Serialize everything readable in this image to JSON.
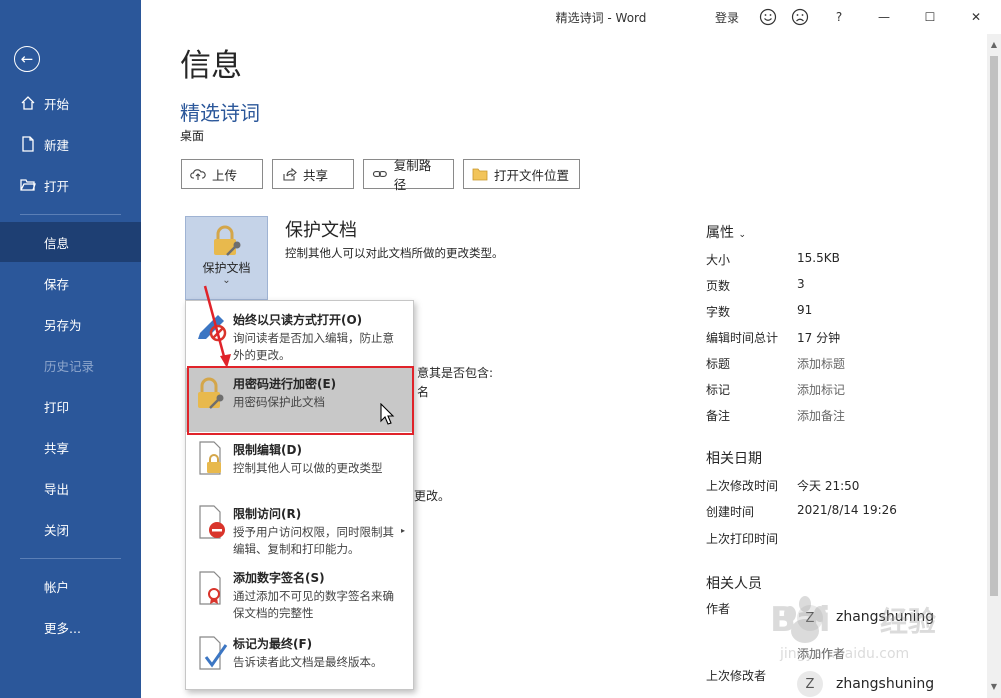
{
  "window": {
    "title": "精选诗词 - Word",
    "signin": "登录",
    "help": "?",
    "minimize": "—",
    "maximize": "☐",
    "close": "✕"
  },
  "sidebar": {
    "back": "←",
    "items": [
      {
        "label": "开始",
        "icon": "home-icon"
      },
      {
        "label": "新建",
        "icon": "new-doc-icon"
      },
      {
        "label": "打开",
        "icon": "open-folder-icon"
      },
      {
        "label": "信息",
        "active": true
      },
      {
        "label": "保存"
      },
      {
        "label": "另存为"
      },
      {
        "label": "历史记录",
        "disabled": true
      },
      {
        "label": "打印"
      },
      {
        "label": "共享"
      },
      {
        "label": "导出"
      },
      {
        "label": "关闭"
      },
      {
        "label": "帐户"
      },
      {
        "label": "更多..."
      }
    ]
  },
  "main": {
    "heading": "信息",
    "doc_name": "精选诗词",
    "doc_location": "桌面",
    "actions": [
      {
        "label": "上传",
        "icon": "cloud-upload-icon"
      },
      {
        "label": "共享",
        "icon": "share-icon"
      },
      {
        "label": "复制路径",
        "icon": "link-icon"
      },
      {
        "label": "打开文件位置",
        "icon": "folder-icon"
      }
    ],
    "protect": {
      "tile_label": "保护文档",
      "chevron": "⌄",
      "title": "保护文档",
      "desc": "控制其他人可以对此文档所做的更改类型。"
    },
    "bg_fragments": [
      "意其是否包含:",
      "名",
      "更改。"
    ]
  },
  "menu": {
    "items": [
      {
        "title": "始终以只读方式打开(O)",
        "desc": "询问读者是否加入编辑，防止意外的更改。",
        "icon": "pencil-block-icon"
      },
      {
        "title": "用密码进行加密(E)",
        "desc": "用密码保护此文档",
        "icon": "lock-key-icon",
        "highlight": true
      },
      {
        "title": "限制编辑(D)",
        "desc": "控制其他人可以做的更改类型",
        "icon": "restrict-edit-icon"
      },
      {
        "title": "限制访问(R)",
        "desc": "授予用户访问权限，同时限制其编辑、复制和打印能力。",
        "icon": "restrict-access-icon",
        "submenu_arrow": "▸"
      },
      {
        "title": "添加数字签名(S)",
        "desc": "通过添加不可见的数字签名来确保文档的完整性",
        "icon": "signature-icon"
      },
      {
        "title": "标记为最终(F)",
        "desc": "告诉读者此文档是最终版本。",
        "icon": "mark-final-icon"
      }
    ]
  },
  "properties": {
    "heading": "属性",
    "rows": [
      {
        "key": "大小",
        "value": "15.5KB"
      },
      {
        "key": "页数",
        "value": "3"
      },
      {
        "key": "字数",
        "value": "91"
      },
      {
        "key": "编辑时间总计",
        "value": "17 分钟"
      },
      {
        "key": "标题",
        "value": "添加标题",
        "placeholder": true
      },
      {
        "key": "标记",
        "value": "添加标记",
        "placeholder": true
      },
      {
        "key": "备注",
        "value": "添加备注",
        "placeholder": true
      }
    ],
    "dates_heading": "相关日期",
    "dates": [
      {
        "key": "上次修改时间",
        "value": "今天 21:50"
      },
      {
        "key": "创建时间",
        "value": "2021/8/14 19:26"
      },
      {
        "key": "上次打印时间",
        "value": ""
      }
    ],
    "people_heading": "相关人员",
    "author_key": "作者",
    "author_initial": "Z",
    "author_name": "zhangshuning",
    "add_author": "添加作者",
    "last_modified_key": "上次修改者",
    "last_modified_initial": "Z",
    "last_modified_name": "zhangshuning"
  },
  "colors": {
    "sidebar": "#2b579a",
    "sidebar_active": "#1e3f73",
    "highlight_box": "#e0232a"
  }
}
